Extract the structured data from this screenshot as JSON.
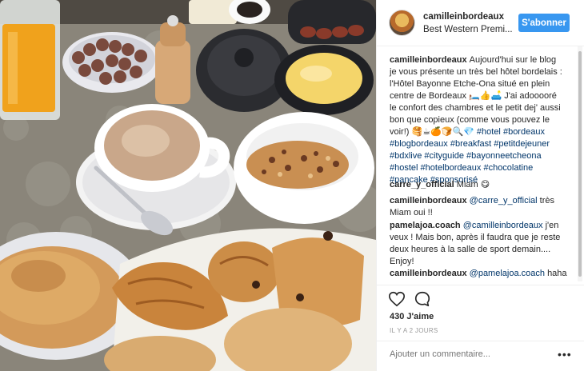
{
  "post": {
    "username": "camilleinbordeaux",
    "location": "Best Western Premi...",
    "follow_label": "S'abonner",
    "caption": {
      "user": "camilleinbordeaux",
      "lines": [
        "Aujourd'hui sur le blog",
        "je vous présente un très bel hôtel bordelais :",
        "l'Hôtel Bayonne Etche-Ona situé en plein",
        "centre de Bordeaux 🛏️👍🛋️ J'ai adooooré",
        "le confort des chambres et le petit dej' aussi",
        "bon que copieux (comme vous pouvez le",
        "voir!) 🥞☕🍊🍞🔍💎 #hotel #bordeaux",
        "#blogbordeaux #breakfast #petitdejeuner",
        "#bdxlive #cityguide #bayonneetcheona",
        "#hostel #hotelbordeaux #chocolatine",
        "#pancake #sponsorisé"
      ]
    },
    "comments": [
      {
        "user": "carre_y_official",
        "text": "Miam 😋"
      },
      {
        "user": "camilleinbordeaux",
        "mention": "@carre_y_official",
        "text": "très Miam oui !!"
      },
      {
        "user": "pamelajoa.coach",
        "mention": "@camilleinbordeaux",
        "text": "j'en veux ! Mais bon, après il faudra que je reste deux heures à la salle de sport demain.... Enjoy!"
      },
      {
        "user": "camilleinbordeaux",
        "mention": "@pamelajoa.coach",
        "text": "haha"
      }
    ],
    "likes": "430 J'aime",
    "time": "IL Y A 2 JOURS",
    "add_comment_placeholder": "Ajouter un commentaire...",
    "more_label": "•••"
  }
}
